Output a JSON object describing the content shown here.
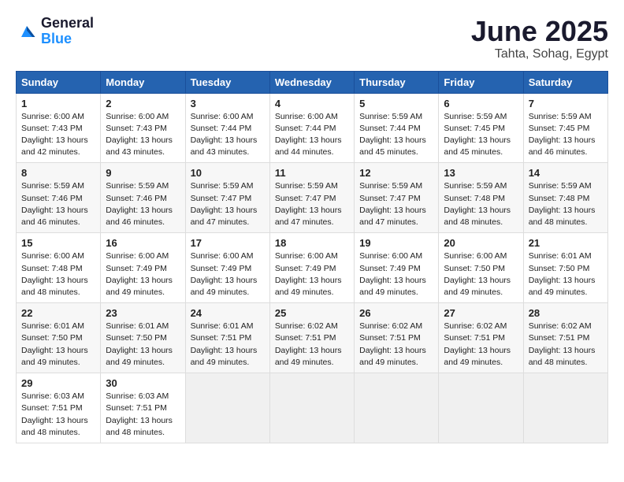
{
  "header": {
    "logo_general": "General",
    "logo_blue": "Blue",
    "title": "June 2025",
    "location": "Tahta, Sohag, Egypt"
  },
  "calendar": {
    "days_of_week": [
      "Sunday",
      "Monday",
      "Tuesday",
      "Wednesday",
      "Thursday",
      "Friday",
      "Saturday"
    ],
    "weeks": [
      [
        null,
        null,
        null,
        null,
        null,
        null,
        null
      ]
    ],
    "cells": [
      {
        "day": null,
        "info": null
      },
      {
        "day": null,
        "info": null
      },
      {
        "day": null,
        "info": null
      },
      {
        "day": null,
        "info": null
      },
      {
        "day": null,
        "info": null
      },
      {
        "day": null,
        "info": null
      },
      {
        "day": null,
        "info": null
      }
    ],
    "rows": [
      [
        {
          "day": "1",
          "sunrise": "6:00 AM",
          "sunset": "7:43 PM",
          "daylight": "13 hours and 42 minutes."
        },
        {
          "day": "2",
          "sunrise": "6:00 AM",
          "sunset": "7:43 PM",
          "daylight": "13 hours and 43 minutes."
        },
        {
          "day": "3",
          "sunrise": "6:00 AM",
          "sunset": "7:44 PM",
          "daylight": "13 hours and 43 minutes."
        },
        {
          "day": "4",
          "sunrise": "6:00 AM",
          "sunset": "7:44 PM",
          "daylight": "13 hours and 44 minutes."
        },
        {
          "day": "5",
          "sunrise": "5:59 AM",
          "sunset": "7:44 PM",
          "daylight": "13 hours and 45 minutes."
        },
        {
          "day": "6",
          "sunrise": "5:59 AM",
          "sunset": "7:45 PM",
          "daylight": "13 hours and 45 minutes."
        },
        {
          "day": "7",
          "sunrise": "5:59 AM",
          "sunset": "7:45 PM",
          "daylight": "13 hours and 46 minutes."
        }
      ],
      [
        {
          "day": "8",
          "sunrise": "5:59 AM",
          "sunset": "7:46 PM",
          "daylight": "13 hours and 46 minutes."
        },
        {
          "day": "9",
          "sunrise": "5:59 AM",
          "sunset": "7:46 PM",
          "daylight": "13 hours and 46 minutes."
        },
        {
          "day": "10",
          "sunrise": "5:59 AM",
          "sunset": "7:47 PM",
          "daylight": "13 hours and 47 minutes."
        },
        {
          "day": "11",
          "sunrise": "5:59 AM",
          "sunset": "7:47 PM",
          "daylight": "13 hours and 47 minutes."
        },
        {
          "day": "12",
          "sunrise": "5:59 AM",
          "sunset": "7:47 PM",
          "daylight": "13 hours and 47 minutes."
        },
        {
          "day": "13",
          "sunrise": "5:59 AM",
          "sunset": "7:48 PM",
          "daylight": "13 hours and 48 minutes."
        },
        {
          "day": "14",
          "sunrise": "5:59 AM",
          "sunset": "7:48 PM",
          "daylight": "13 hours and 48 minutes."
        }
      ],
      [
        {
          "day": "15",
          "sunrise": "6:00 AM",
          "sunset": "7:48 PM",
          "daylight": "13 hours and 48 minutes."
        },
        {
          "day": "16",
          "sunrise": "6:00 AM",
          "sunset": "7:49 PM",
          "daylight": "13 hours and 49 minutes."
        },
        {
          "day": "17",
          "sunrise": "6:00 AM",
          "sunset": "7:49 PM",
          "daylight": "13 hours and 49 minutes."
        },
        {
          "day": "18",
          "sunrise": "6:00 AM",
          "sunset": "7:49 PM",
          "daylight": "13 hours and 49 minutes."
        },
        {
          "day": "19",
          "sunrise": "6:00 AM",
          "sunset": "7:49 PM",
          "daylight": "13 hours and 49 minutes."
        },
        {
          "day": "20",
          "sunrise": "6:00 AM",
          "sunset": "7:50 PM",
          "daylight": "13 hours and 49 minutes."
        },
        {
          "day": "21",
          "sunrise": "6:01 AM",
          "sunset": "7:50 PM",
          "daylight": "13 hours and 49 minutes."
        }
      ],
      [
        {
          "day": "22",
          "sunrise": "6:01 AM",
          "sunset": "7:50 PM",
          "daylight": "13 hours and 49 minutes."
        },
        {
          "day": "23",
          "sunrise": "6:01 AM",
          "sunset": "7:50 PM",
          "daylight": "13 hours and 49 minutes."
        },
        {
          "day": "24",
          "sunrise": "6:01 AM",
          "sunset": "7:51 PM",
          "daylight": "13 hours and 49 minutes."
        },
        {
          "day": "25",
          "sunrise": "6:02 AM",
          "sunset": "7:51 PM",
          "daylight": "13 hours and 49 minutes."
        },
        {
          "day": "26",
          "sunrise": "6:02 AM",
          "sunset": "7:51 PM",
          "daylight": "13 hours and 49 minutes."
        },
        {
          "day": "27",
          "sunrise": "6:02 AM",
          "sunset": "7:51 PM",
          "daylight": "13 hours and 49 minutes."
        },
        {
          "day": "28",
          "sunrise": "6:02 AM",
          "sunset": "7:51 PM",
          "daylight": "13 hours and 48 minutes."
        }
      ],
      [
        {
          "day": "29",
          "sunrise": "6:03 AM",
          "sunset": "7:51 PM",
          "daylight": "13 hours and 48 minutes."
        },
        {
          "day": "30",
          "sunrise": "6:03 AM",
          "sunset": "7:51 PM",
          "daylight": "13 hours and 48 minutes."
        },
        null,
        null,
        null,
        null,
        null
      ]
    ]
  }
}
